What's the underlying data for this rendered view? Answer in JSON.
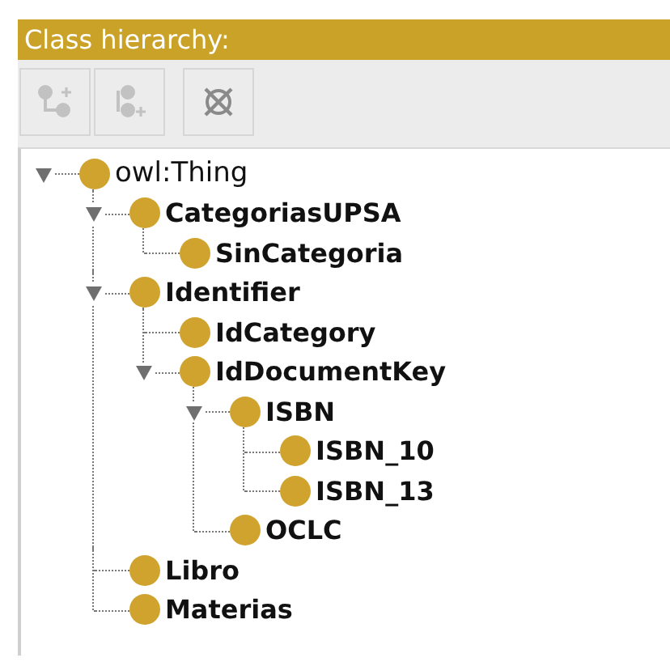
{
  "panel": {
    "title": "Class hierarchy:"
  },
  "toolbar": [
    {
      "kind": "add_subclass",
      "disabled": true
    },
    {
      "kind": "add_sibling",
      "disabled": true
    },
    {
      "kind": "delete",
      "disabled": false
    }
  ],
  "tree": [
    {
      "label": "owl:Thing",
      "expanded": true,
      "children": [
        {
          "label": "CategoriasUPSA",
          "expanded": true,
          "children": [
            {
              "label": "SinCategoria"
            }
          ]
        },
        {
          "label": "Identifier",
          "expanded": true,
          "children": [
            {
              "label": "IdCategory"
            },
            {
              "label": "IdDocumentKey",
              "expanded": true,
              "children": [
                {
                  "label": "ISBN",
                  "expanded": true,
                  "children": [
                    {
                      "label": "ISBN_10"
                    },
                    {
                      "label": "ISBN_13"
                    }
                  ]
                },
                {
                  "label": "OCLC"
                }
              ]
            }
          ]
        },
        {
          "label": "Libro"
        },
        {
          "label": "Materias"
        }
      ]
    }
  ]
}
